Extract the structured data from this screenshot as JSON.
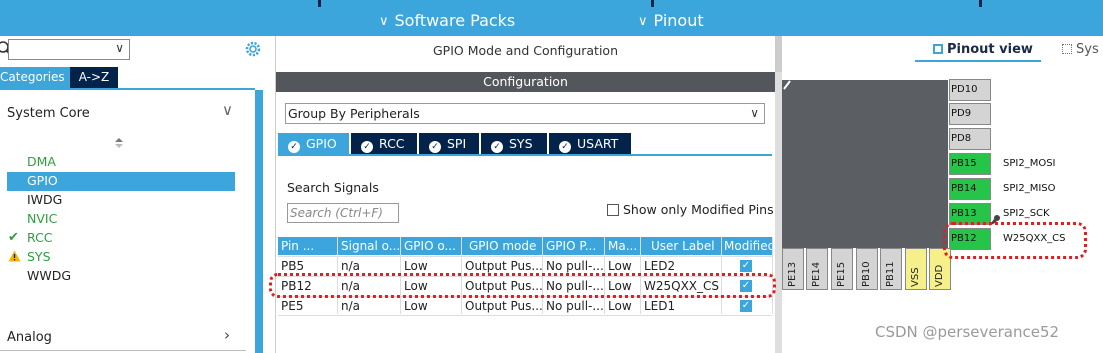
{
  "header": {
    "submenu": [
      {
        "label": "Software Packs"
      },
      {
        "label": "Pinout"
      }
    ]
  },
  "left_panel": {
    "tabs": {
      "categories": "Categories",
      "az": "A->Z"
    },
    "section_title": "System Core",
    "items": [
      {
        "label": "DMA",
        "color": "#2e9e3e",
        "status": ""
      },
      {
        "label": "GPIO",
        "color": "#ffffff",
        "status": "selected"
      },
      {
        "label": "IWDG",
        "color": "#222222",
        "status": ""
      },
      {
        "label": "NVIC",
        "color": "#2e9e3e",
        "status": ""
      },
      {
        "label": "RCC",
        "color": "#2e9e3e",
        "status": "check"
      },
      {
        "label": "SYS",
        "color": "#2e9e3e",
        "status": "warning"
      },
      {
        "label": "WWDG",
        "color": "#222222",
        "status": ""
      }
    ],
    "analog_label": "Analog"
  },
  "middle_panel": {
    "title": "GPIO Mode and Configuration",
    "config_label": "Configuration",
    "group_select": "Group By Peripherals",
    "peripheral_tabs": [
      {
        "label": "GPIO",
        "active": true
      },
      {
        "label": "RCC",
        "active": false
      },
      {
        "label": "SPI",
        "active": false
      },
      {
        "label": "SYS",
        "active": false
      },
      {
        "label": "USART",
        "active": false
      }
    ],
    "search_signals_label": "Search Signals",
    "search_placeholder": "Search (Ctrl+F)",
    "modified_only_label": "Show only Modified Pins",
    "table": {
      "headers": [
        "Pin ...",
        "Signal o...",
        "GPIO o...",
        "GPIO mode",
        "GPIO P...",
        "Ma...",
        "User Label",
        "Modified"
      ],
      "rows": [
        {
          "cells": [
            "PB5",
            "n/a",
            "Low",
            "Output Pus...",
            "No pull-...",
            "Low",
            "LED2"
          ],
          "modified": true
        },
        {
          "cells": [
            "PB12",
            "n/a",
            "Low",
            "Output Pus...",
            "No pull-...",
            "Low",
            "W25QXX_CS"
          ],
          "modified": true
        },
        {
          "cells": [
            "PE5",
            "n/a",
            "Low",
            "Output Pus...",
            "No pull-...",
            "Low",
            "LED1"
          ],
          "modified": true
        }
      ]
    }
  },
  "right_panel": {
    "tabs": {
      "pinout_view": "Pinout view",
      "system_view": "Sys"
    },
    "right_pins": [
      {
        "name": "PD10",
        "label": "",
        "state": "gray"
      },
      {
        "name": "PD9",
        "label": "",
        "state": "gray"
      },
      {
        "name": "PD8",
        "label": "",
        "state": "gray"
      },
      {
        "name": "PB15",
        "label": "SPI2_MOSI",
        "state": "green"
      },
      {
        "name": "PB14",
        "label": "SPI2_MISO",
        "state": "green"
      },
      {
        "name": "PB13",
        "label": "SPI2_SCK",
        "state": "green"
      },
      {
        "name": "PB12",
        "label": "W25QXX_CS",
        "state": "green"
      }
    ],
    "bottom_pins": [
      {
        "name": "PE13",
        "state": "gray"
      },
      {
        "name": "PE14",
        "state": "gray"
      },
      {
        "name": "PE15",
        "state": "gray"
      },
      {
        "name": "PB10",
        "state": "gray"
      },
      {
        "name": "PB11",
        "state": "gray"
      },
      {
        "name": "VSS",
        "state": "yellow"
      },
      {
        "name": "VDD",
        "state": "yellow"
      }
    ]
  },
  "watermark": "CSDN @perseverance52"
}
